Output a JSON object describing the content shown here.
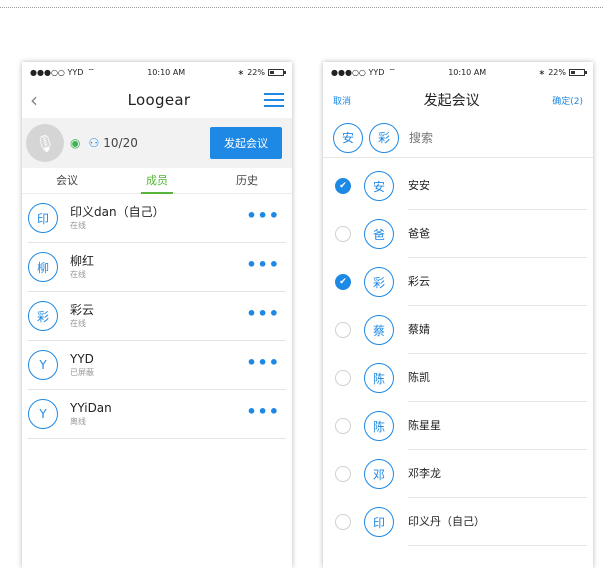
{
  "left": {
    "status": {
      "carrier": "●●●○○ YYD",
      "time": "10:10 AM",
      "battery": "22%"
    },
    "nav": {
      "back_icon": "‹",
      "title": "Loogear",
      "menu_icon": "menu-icon"
    },
    "meeting": {
      "count": "10/20",
      "start_label": "发起会议"
    },
    "tabs": [
      {
        "label": "会议",
        "active": false
      },
      {
        "label": "成员",
        "active": true
      },
      {
        "label": "历史",
        "active": false
      }
    ],
    "members": [
      {
        "avatar": "印",
        "name": "印义dan（自己）",
        "status": "在线"
      },
      {
        "avatar": "柳",
        "name": "柳红",
        "status": "在线"
      },
      {
        "avatar": "彩",
        "name": "彩云",
        "status": "在线"
      },
      {
        "avatar": "Y",
        "name": "YYD",
        "status": "已屏蔽"
      },
      {
        "avatar": "Y",
        "name": "YYiDan",
        "status": "离线"
      }
    ]
  },
  "right": {
    "status": {
      "carrier": "●●●○○ YYD",
      "time": "10:10 AM",
      "battery": "22%"
    },
    "nav": {
      "cancel": "取消",
      "title": "发起会议",
      "confirm": "确定(2)"
    },
    "selected": [
      "安",
      "彩"
    ],
    "search": {
      "placeholder": "搜索"
    },
    "contacts": [
      {
        "avatar": "安",
        "name": "安安",
        "checked": true
      },
      {
        "avatar": "爸",
        "name": "爸爸",
        "checked": false
      },
      {
        "avatar": "彩",
        "name": "彩云",
        "checked": true
      },
      {
        "avatar": "蔡",
        "name": "蔡婧",
        "checked": false
      },
      {
        "avatar": "陈",
        "name": "陈凯",
        "checked": false
      },
      {
        "avatar": "陈",
        "name": "陈星星",
        "checked": false
      },
      {
        "avatar": "邓",
        "name": "邓李龙",
        "checked": false
      },
      {
        "avatar": "印",
        "name": "印义丹（自己）",
        "checked": false
      }
    ]
  },
  "colors": {
    "accent": "#1e88e5",
    "active_tab": "#55b53a",
    "online_signal": "#3eb454"
  }
}
